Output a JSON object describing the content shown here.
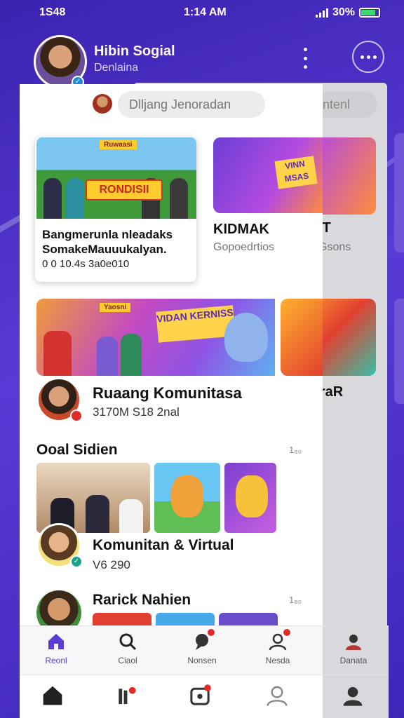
{
  "status": {
    "left": "1S48",
    "time": "1:14 AM",
    "battery": "30%"
  },
  "header": {
    "name": "Hibin Sogial",
    "subtitle": "Denlaina"
  },
  "search": {
    "placeholder": "Dlljang Jenoradan"
  },
  "back_card": {
    "pill": "antenl",
    "title": "IT",
    "subtitle": "Gsons",
    "title2": "rraR"
  },
  "feed": {
    "card1": {
      "tag": "Ruwaasi",
      "banner": "RONDISII",
      "caption": "Bangmerunla nleadaks SomakeMauuukalyan.",
      "meta": "0 0 10.4s 3a0e010"
    },
    "card2": {
      "badge": "VINN MSAS",
      "title": "KIDMAK",
      "subtitle": "Gopoedrtios"
    },
    "community": {
      "tag": "Yaosni",
      "banner": "VIDAN KERNISS",
      "title": "Ruaang Komunitasa",
      "meta": "3170M S18 2nal"
    },
    "section": {
      "title": "Ooal Sidien",
      "more": "1₈₀"
    },
    "kv": {
      "title": "Komunitan & Virtual",
      "meta": "V6 290"
    },
    "rn": {
      "title": "Rarick Nahien",
      "more": "1₈₀"
    }
  },
  "tabs": [
    {
      "label": "Reonl",
      "icon": "home-icon"
    },
    {
      "label": "Ciaol",
      "icon": "search-icon"
    },
    {
      "label": "Nonsen",
      "icon": "chat-icon"
    },
    {
      "label": "Nesda",
      "icon": "profile-icon"
    },
    {
      "label": "Danata",
      "icon": "group-icon"
    }
  ],
  "colors": {
    "accent": "#5b3bd4",
    "background": "#4b2fc2",
    "badge": "#e02b2b"
  }
}
